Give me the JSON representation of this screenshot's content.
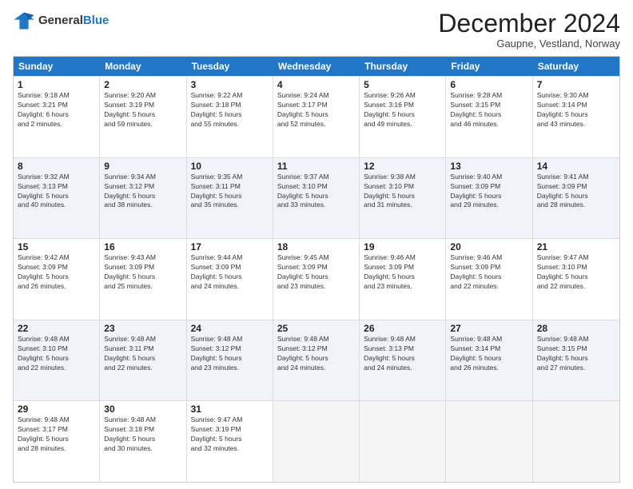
{
  "header": {
    "logo_general": "General",
    "logo_blue": "Blue",
    "month_title": "December 2024",
    "location": "Gaupne, Vestland, Norway"
  },
  "weekdays": [
    "Sunday",
    "Monday",
    "Tuesday",
    "Wednesday",
    "Thursday",
    "Friday",
    "Saturday"
  ],
  "rows": [
    [
      {
        "day": "1",
        "info": "Sunrise: 9:18 AM\nSunset: 3:21 PM\nDaylight: 6 hours\nand 2 minutes."
      },
      {
        "day": "2",
        "info": "Sunrise: 9:20 AM\nSunset: 3:19 PM\nDaylight: 5 hours\nand 59 minutes."
      },
      {
        "day": "3",
        "info": "Sunrise: 9:22 AM\nSunset: 3:18 PM\nDaylight: 5 hours\nand 55 minutes."
      },
      {
        "day": "4",
        "info": "Sunrise: 9:24 AM\nSunset: 3:17 PM\nDaylight: 5 hours\nand 52 minutes."
      },
      {
        "day": "5",
        "info": "Sunrise: 9:26 AM\nSunset: 3:16 PM\nDaylight: 5 hours\nand 49 minutes."
      },
      {
        "day": "6",
        "info": "Sunrise: 9:28 AM\nSunset: 3:15 PM\nDaylight: 5 hours\nand 46 minutes."
      },
      {
        "day": "7",
        "info": "Sunrise: 9:30 AM\nSunset: 3:14 PM\nDaylight: 5 hours\nand 43 minutes."
      }
    ],
    [
      {
        "day": "8",
        "info": "Sunrise: 9:32 AM\nSunset: 3:13 PM\nDaylight: 5 hours\nand 40 minutes."
      },
      {
        "day": "9",
        "info": "Sunrise: 9:34 AM\nSunset: 3:12 PM\nDaylight: 5 hours\nand 38 minutes."
      },
      {
        "day": "10",
        "info": "Sunrise: 9:35 AM\nSunset: 3:11 PM\nDaylight: 5 hours\nand 35 minutes."
      },
      {
        "day": "11",
        "info": "Sunrise: 9:37 AM\nSunset: 3:10 PM\nDaylight: 5 hours\nand 33 minutes."
      },
      {
        "day": "12",
        "info": "Sunrise: 9:38 AM\nSunset: 3:10 PM\nDaylight: 5 hours\nand 31 minutes."
      },
      {
        "day": "13",
        "info": "Sunrise: 9:40 AM\nSunset: 3:09 PM\nDaylight: 5 hours\nand 29 minutes."
      },
      {
        "day": "14",
        "info": "Sunrise: 9:41 AM\nSunset: 3:09 PM\nDaylight: 5 hours\nand 28 minutes."
      }
    ],
    [
      {
        "day": "15",
        "info": "Sunrise: 9:42 AM\nSunset: 3:09 PM\nDaylight: 5 hours\nand 26 minutes."
      },
      {
        "day": "16",
        "info": "Sunrise: 9:43 AM\nSunset: 3:09 PM\nDaylight: 5 hours\nand 25 minutes."
      },
      {
        "day": "17",
        "info": "Sunrise: 9:44 AM\nSunset: 3:09 PM\nDaylight: 5 hours\nand 24 minutes."
      },
      {
        "day": "18",
        "info": "Sunrise: 9:45 AM\nSunset: 3:09 PM\nDaylight: 5 hours\nand 23 minutes."
      },
      {
        "day": "19",
        "info": "Sunrise: 9:46 AM\nSunset: 3:09 PM\nDaylight: 5 hours\nand 23 minutes."
      },
      {
        "day": "20",
        "info": "Sunrise: 9:46 AM\nSunset: 3:09 PM\nDaylight: 5 hours\nand 22 minutes."
      },
      {
        "day": "21",
        "info": "Sunrise: 9:47 AM\nSunset: 3:10 PM\nDaylight: 5 hours\nand 22 minutes."
      }
    ],
    [
      {
        "day": "22",
        "info": "Sunrise: 9:48 AM\nSunset: 3:10 PM\nDaylight: 5 hours\nand 22 minutes."
      },
      {
        "day": "23",
        "info": "Sunrise: 9:48 AM\nSunset: 3:11 PM\nDaylight: 5 hours\nand 22 minutes."
      },
      {
        "day": "24",
        "info": "Sunrise: 9:48 AM\nSunset: 3:12 PM\nDaylight: 5 hours\nand 23 minutes."
      },
      {
        "day": "25",
        "info": "Sunrise: 9:48 AM\nSunset: 3:12 PM\nDaylight: 5 hours\nand 24 minutes."
      },
      {
        "day": "26",
        "info": "Sunrise: 9:48 AM\nSunset: 3:13 PM\nDaylight: 5 hours\nand 24 minutes."
      },
      {
        "day": "27",
        "info": "Sunrise: 9:48 AM\nSunset: 3:14 PM\nDaylight: 5 hours\nand 26 minutes."
      },
      {
        "day": "28",
        "info": "Sunrise: 9:48 AM\nSunset: 3:15 PM\nDaylight: 5 hours\nand 27 minutes."
      }
    ],
    [
      {
        "day": "29",
        "info": "Sunrise: 9:48 AM\nSunset: 3:17 PM\nDaylight: 5 hours\nand 28 minutes."
      },
      {
        "day": "30",
        "info": "Sunrise: 9:48 AM\nSunset: 3:18 PM\nDaylight: 5 hours\nand 30 minutes."
      },
      {
        "day": "31",
        "info": "Sunrise: 9:47 AM\nSunset: 3:19 PM\nDaylight: 5 hours\nand 32 minutes."
      },
      {
        "day": "",
        "info": ""
      },
      {
        "day": "",
        "info": ""
      },
      {
        "day": "",
        "info": ""
      },
      {
        "day": "",
        "info": ""
      }
    ]
  ]
}
